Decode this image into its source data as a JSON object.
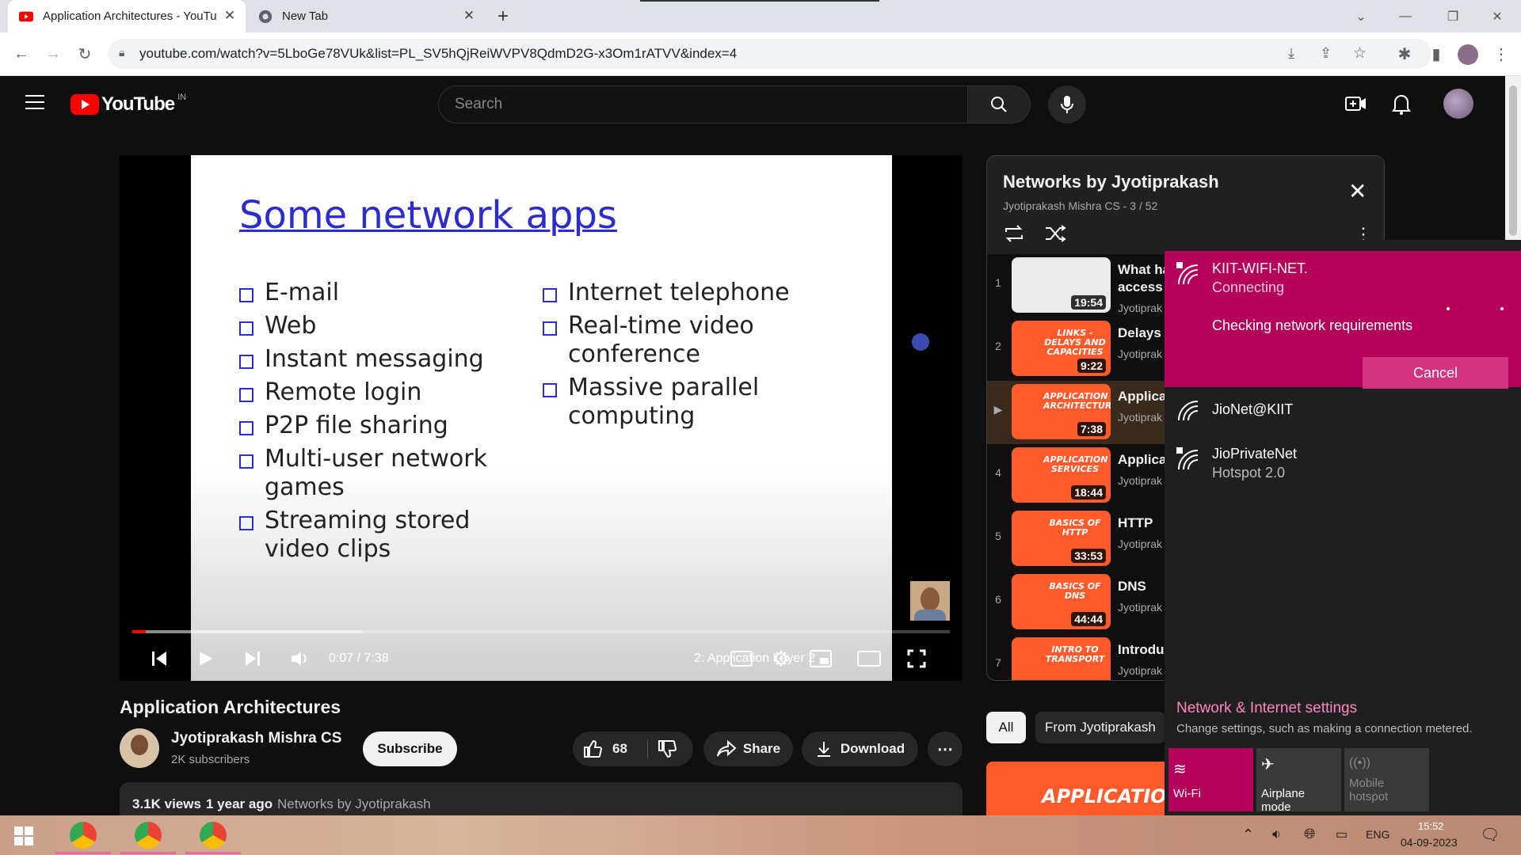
{
  "browser": {
    "tabs": [
      {
        "title": "Application Architectures - YouTu",
        "active": true
      },
      {
        "title": "New Tab",
        "active": false
      }
    ],
    "url": "youtube.com/watch?v=5LboGe78VUk&list=PL_SV5hQjReiWVPV8QdmD2G-x3Om1rATVV&index=4"
  },
  "youtube": {
    "logo_text": "YouTube",
    "country": "IN",
    "search_placeholder": "Search"
  },
  "video": {
    "slide_title": "Some network apps",
    "bullets_left": [
      "E-mail",
      "Web",
      "Instant messaging",
      "Remote login",
      "P2P file sharing",
      "Multi-user network games",
      "Streaming stored video clips"
    ],
    "bullets_right": [
      "Internet telephone",
      "Real-time video conference",
      "Massive parallel computing"
    ],
    "time": "0:07 / 7:38",
    "chapter": "2: Application Layer 2",
    "progress_fraction": 0.016,
    "title": "Application Architectures",
    "channel": "Jyotiprakash Mishra CS",
    "subscribers": "2K subscribers",
    "subscribe_label": "Subscribe",
    "likes": "68",
    "share_label": "Share",
    "download_label": "Download",
    "views": "3.1K views",
    "age": "1 year ago",
    "playlist_link": "Networks by Jyotiprakash"
  },
  "playlist": {
    "title": "Networks by Jyotiprakash",
    "subtitle": "Jyotiprakash Mishra CS - 3 / 52",
    "items": [
      {
        "index": "1",
        "title": "What ha",
        "title2": "access",
        "channel": "Jyotiprak",
        "duration": "19:54",
        "thumb_text": ""
      },
      {
        "index": "2",
        "title": "Delays a",
        "channel": "Jyotiprak",
        "duration": "9:22",
        "thumb_text": "LINKS - DELAYS AND CAPACITIES"
      },
      {
        "index": "▶",
        "title": "Applica",
        "channel": "Jyotiprak",
        "duration": "7:38",
        "thumb_text": "APPLICATION ARCHITECTURES"
      },
      {
        "index": "4",
        "title": "Applica",
        "channel": "Jyotiprak",
        "duration": "18:44",
        "thumb_text": "APPLICATION SERVICES"
      },
      {
        "index": "5",
        "title": "HTTP",
        "channel": "Jyotiprak",
        "duration": "33:53",
        "thumb_text": "BASICS OF HTTP"
      },
      {
        "index": "6",
        "title": "DNS",
        "channel": "Jyotiprak",
        "duration": "44:44",
        "thumb_text": "BASICS OF DNS"
      },
      {
        "index": "7",
        "title": "Introdu",
        "channel": "Jyotiprak",
        "duration": "",
        "thumb_text": "INTRO TO TRANSPORT"
      }
    ]
  },
  "chips": [
    "All",
    "From Jyotiprakash"
  ],
  "next_thumb_text": "APPLICATION",
  "wifi": {
    "connecting_network": "KIIT-WIFI-NET.",
    "connecting_status": "Connecting",
    "checking_text": "Checking network requirements",
    "cancel_label": "Cancel",
    "networks": [
      {
        "name": "JioNet@KIIT",
        "sub": ""
      },
      {
        "name": "JioPrivateNet",
        "sub": "Hotspot 2.0"
      }
    ],
    "settings_title": "Network & Internet settings",
    "settings_desc": "Change settings, such as making a connection metered.",
    "tiles": [
      "Wi-Fi",
      "Airplane mode",
      "Mobile hotspot"
    ]
  },
  "taskbar": {
    "lang": "ENG",
    "time": "15:52",
    "date": "04-09-2023"
  }
}
